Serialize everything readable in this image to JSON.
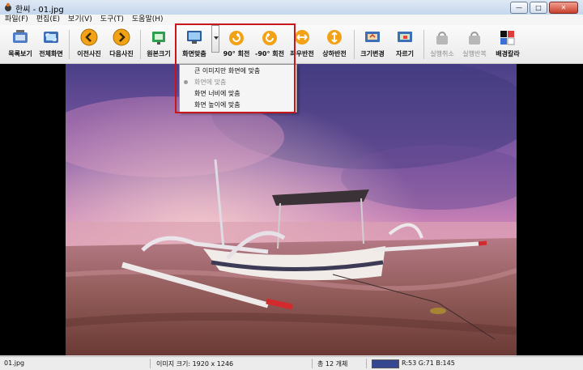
{
  "window": {
    "title": "한씨 - 01.jpg"
  },
  "menu": [
    "파일(F)",
    "편집(E)",
    "보기(V)",
    "도구(T)",
    "도움말(H)"
  ],
  "toolbar": {
    "items": [
      {
        "label": "목록보기",
        "icon": "list-view-icon"
      },
      {
        "label": "전체화면",
        "icon": "fullscreen-icon"
      },
      {
        "label": "이전사진",
        "icon": "previous-icon"
      },
      {
        "label": "다음사진",
        "icon": "next-icon"
      },
      {
        "label": "원본크기",
        "icon": "original-size-icon"
      },
      {
        "label": "화면맞춤",
        "icon": "fit-screen-icon"
      },
      {
        "label": "90° 회전",
        "icon": "rotate-cw-icon"
      },
      {
        "label": "-90° 회전",
        "icon": "rotate-ccw-icon"
      },
      {
        "label": "좌우반전",
        "icon": "flip-horizontal-icon"
      },
      {
        "label": "상하반전",
        "icon": "flip-vertical-icon"
      },
      {
        "label": "크기변경",
        "icon": "resize-icon"
      },
      {
        "label": "자르기",
        "icon": "crop-icon"
      },
      {
        "label": "실행취소",
        "icon": "undo-icon",
        "disabled": true
      },
      {
        "label": "실행반복",
        "icon": "redo-icon",
        "disabled": true
      },
      {
        "label": "배경칼라",
        "icon": "background-color-icon"
      }
    ]
  },
  "fit_menu": {
    "items": [
      {
        "label": "큰 이미지만 화면에 맞춤",
        "disabled": false
      },
      {
        "label": "화면에 맞춤",
        "disabled": true,
        "selected": true
      },
      {
        "label": "화면 너비에 맞춤",
        "disabled": false
      },
      {
        "label": "화면 높이에 맞춤",
        "disabled": false
      }
    ]
  },
  "status": {
    "filename": "01.jpg",
    "image_size": "이미지 크기: 1920 x 1246",
    "count": "총 12 개체",
    "pixel_color": "R:53 G:71 B:145",
    "swatch_color": "#354791"
  },
  "colors": {
    "highlight": "#c8161d",
    "canvas": "#000000"
  }
}
